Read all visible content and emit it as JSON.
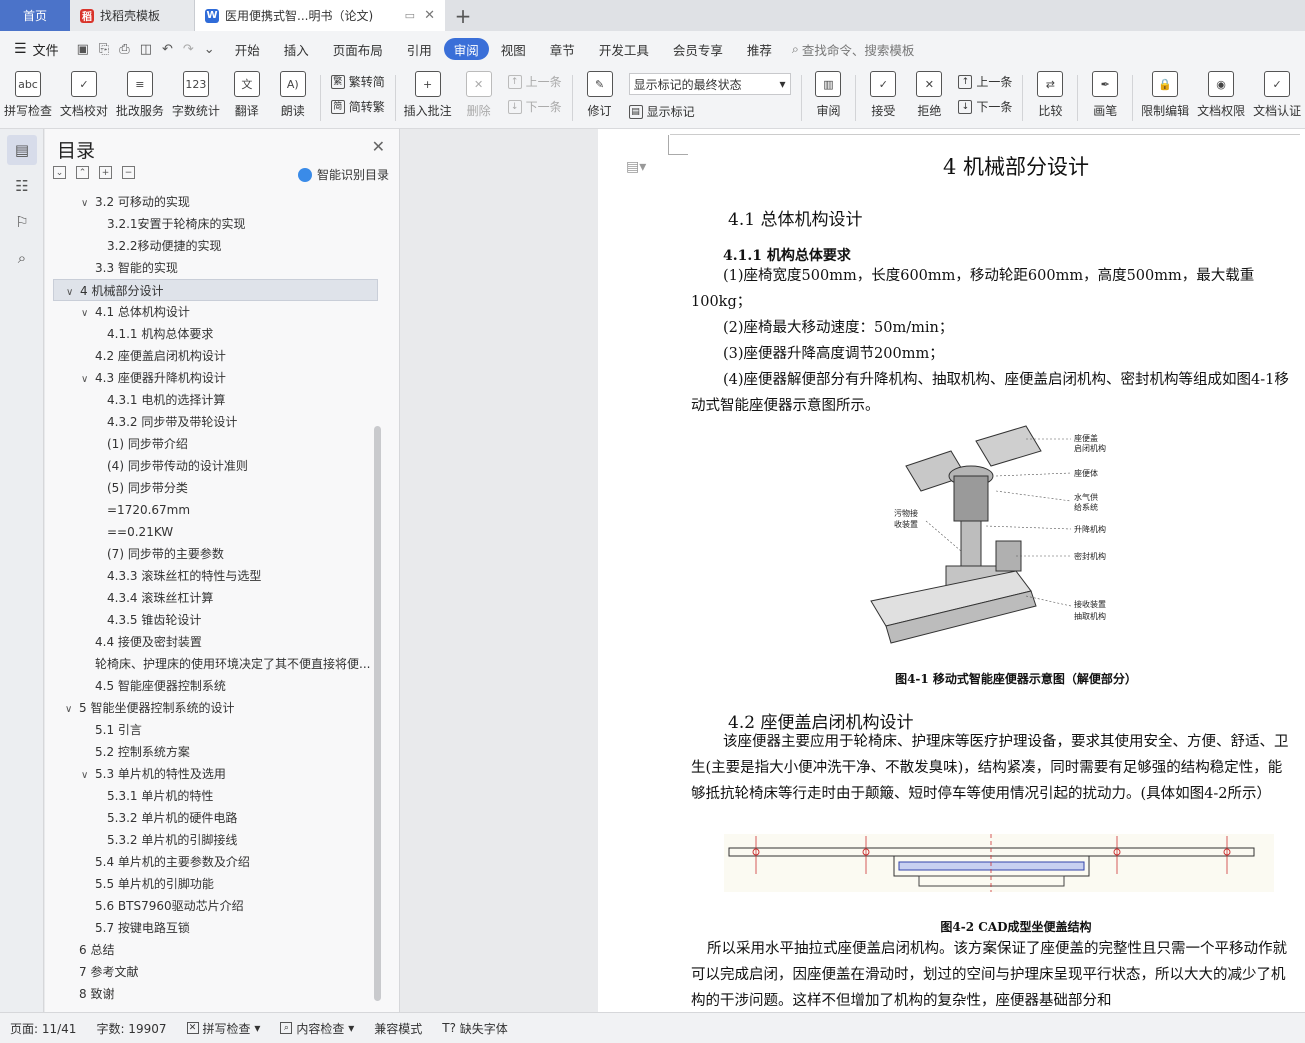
{
  "tabs": {
    "home": "首页",
    "template": "找稻壳模板",
    "document": "医用便携式智...明书（论文)"
  },
  "menu": {
    "file": "文件",
    "items": [
      "开始",
      "插入",
      "页面布局",
      "引用",
      "审阅",
      "视图",
      "章节",
      "开发工具",
      "会员专享",
      "推荐"
    ],
    "active": "审阅",
    "search_placeholder": "查找命令、搜索模板"
  },
  "ribbon": {
    "spellcheck": "拼写检查",
    "doc_check": "文档校对",
    "batch_service": "批改服务",
    "word_count": "字数统计",
    "translate": "翻译",
    "read_aloud": "朗读",
    "to_traditional": "繁转简",
    "to_simplified": "简转繁",
    "insert_comment": "插入批注",
    "delete": "删除",
    "prev": "上一条",
    "next": "下一条",
    "track": "修订",
    "markup_state": "显示标记的最终状态",
    "show_markup": "显示标记",
    "review": "审阅",
    "accept": "接受",
    "reject": "拒绝",
    "prev2": "上一条",
    "next2": "下一条",
    "compare": "比较",
    "ink": "画笔",
    "restrict_edit": "限制编辑",
    "doc_permission": "文档权限",
    "doc_cert": "文档认证"
  },
  "toc": {
    "title": "目录",
    "smart": "智能识别目录",
    "items": [
      {
        "level": 2,
        "chev": true,
        "text": "3.2 可移动的实现"
      },
      {
        "level": 3,
        "chev": false,
        "text": "3.2.1安置于轮椅床的实现"
      },
      {
        "level": 3,
        "chev": false,
        "text": "3.2.2移动便捷的实现"
      },
      {
        "level": 2,
        "chev": false,
        "text": "3.3 智能的实现"
      },
      {
        "level": 1,
        "chev": true,
        "text": "4 机械部分设计",
        "selected": true
      },
      {
        "level": 2,
        "chev": true,
        "text": "4.1 总体机构设计"
      },
      {
        "level": 3,
        "chev": false,
        "text": "4.1.1 机构总体要求"
      },
      {
        "level": 2,
        "chev": false,
        "text": "4.2 座便盖启闭机构设计"
      },
      {
        "level": 2,
        "chev": true,
        "text": "4.3 座便器升降机构设计"
      },
      {
        "level": 3,
        "chev": false,
        "text": "4.3.1 电机的选择计算"
      },
      {
        "level": 3,
        "chev": false,
        "text": "4.3.2 同步带及带轮设计"
      },
      {
        "level": 3,
        "chev": false,
        "text": "(1)  同步带介绍"
      },
      {
        "level": 3,
        "chev": false,
        "text": "(4)  同步带传动的设计准则"
      },
      {
        "level": 3,
        "chev": false,
        "text": "(5)  同步带分类"
      },
      {
        "level": 3,
        "chev": false,
        "text": "=1720.67mm"
      },
      {
        "level": 3,
        "chev": false,
        "text": "==0.21KW"
      },
      {
        "level": 3,
        "chev": false,
        "text": "(7)  同步带的主要参数"
      },
      {
        "level": 3,
        "chev": false,
        "text": "4.3.3 滚珠丝杠的特性与选型"
      },
      {
        "level": 3,
        "chev": false,
        "text": "4.3.4 滚珠丝杠计算"
      },
      {
        "level": 3,
        "chev": false,
        "text": "4.3.5 锥齿轮设计"
      },
      {
        "level": 2,
        "chev": false,
        "text": "4.4 接便及密封装置"
      },
      {
        "level": 2,
        "chev": false,
        "text": "轮椅床、护理床的使用环境决定了其不便直接将便..."
      },
      {
        "level": 2,
        "chev": false,
        "text": "4.5 智能座便器控制系统"
      },
      {
        "level": 1,
        "chev": true,
        "text": "5 智能坐便器控制系统的设计"
      },
      {
        "level": 2,
        "chev": false,
        "text": "5.1 引言"
      },
      {
        "level": 2,
        "chev": false,
        "text": "5.2 控制系统方案"
      },
      {
        "level": 2,
        "chev": true,
        "text": "5.3 单片机的特性及选用"
      },
      {
        "level": 3,
        "chev": false,
        "text": "5.3.1 单片机的特性"
      },
      {
        "level": 3,
        "chev": false,
        "text": "5.3.2 单片机的硬件电路"
      },
      {
        "level": 3,
        "chev": false,
        "text": "5.3.2 单片机的引脚接线"
      },
      {
        "level": 2,
        "chev": false,
        "text": "5.4 单片机的主要参数及介绍"
      },
      {
        "level": 2,
        "chev": false,
        "text": "5.5 单片机的引脚功能"
      },
      {
        "level": 2,
        "chev": false,
        "text": "5.6 BTS7960驱动芯片介绍"
      },
      {
        "level": 2,
        "chev": false,
        "text": "5.7 按键电路互锁"
      },
      {
        "level": 1,
        "chev": false,
        "text": "6 总结"
      },
      {
        "level": 1,
        "chev": false,
        "text": "7 参考文献"
      },
      {
        "level": 1,
        "chev": false,
        "text": "8 致谢"
      }
    ]
  },
  "doc": {
    "h1": "4 机械部分设计",
    "h2_1": "4.1 总体机构设计",
    "h3_1": "4.1.1 机构总体要求",
    "p1": "(1)座椅宽度500mm，长度600mm，移动轮距600mm，高度500mm，最大载重100kg；",
    "p2": "(2)座椅最大移动速度：50m/min；",
    "p3": "(3)座便器升降高度调节200mm；",
    "p4": "(4)座便器解便部分有升降机构、抽取机构、座便盖启闭机构、密封机构等组成如图4-1移动式智能座便器示意图所示。",
    "fig1_labels": [
      "座便盖启闭机构",
      "座便体",
      "水气供给系统",
      "升降机构",
      "密封机构",
      "接收装置抽取机构",
      "污物接收装置"
    ],
    "fig1_caption": "图4-1 移动式智能座便器示意图（解便部分）",
    "h2_2": "4.2 座便盖启闭机构设计",
    "p5": "该座便器主要应用于轮椅床、护理床等医疗护理设备，要求其使用安全、方便、舒适、卫生(主要是指大小便冲洗干净、不散发臭味)，结构紧凑，同时需要有足够强的结构稳定性，能够抵抗轮椅床等行走时由于颠簸、短时停车等使用情况引起的扰动力。(具体如图4-2所示）",
    "fig2_caption": "图4-2 CAD成型坐便盖结构",
    "p6": "所以采用水平抽拉式座便盖启闭机构。该方案保证了座便盖的完整性且只需一个平移动作就可以完成启闭，因座便盖在滑动时，划过的空间与护理床呈现平行状态，所以大大的减少了机构的干涉问题。这样不但增加了机构的复杂性，座便器基础部分和"
  },
  "status": {
    "page": "页面: 11/41",
    "words": "字数: 19907",
    "spell": "拼写检查",
    "content": "内容检查",
    "compat": "兼容模式",
    "missing_font": "缺失字体"
  }
}
